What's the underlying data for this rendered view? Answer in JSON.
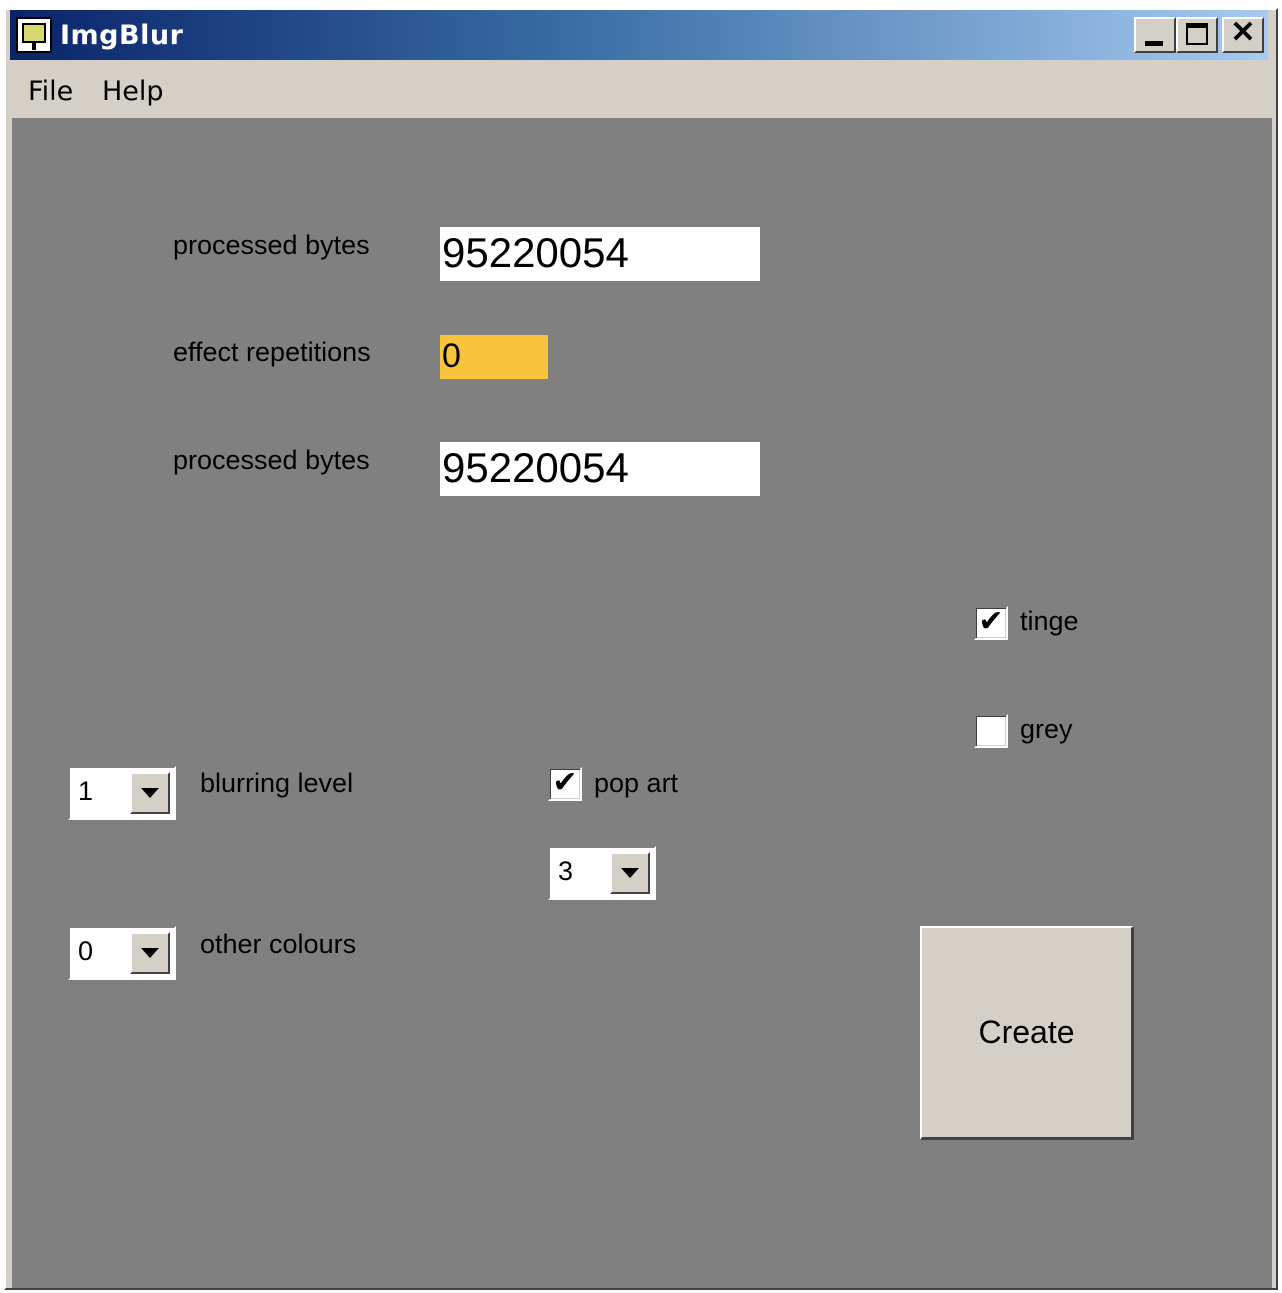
{
  "window": {
    "title": "ImgBlur"
  },
  "menu": {
    "file": "File",
    "help": "Help"
  },
  "fields": {
    "processed_bytes_1": {
      "label": "processed bytes",
      "value": "95220054"
    },
    "effect_repetitions": {
      "label": "effect repetitions",
      "value": "0"
    },
    "processed_bytes_2": {
      "label": "processed bytes",
      "value": "95220054"
    }
  },
  "checkboxes": {
    "tinge": {
      "label": "tinge",
      "checked": true,
      "mark": "✔"
    },
    "grey": {
      "label": "grey",
      "checked": false,
      "mark": ""
    },
    "pop_art": {
      "label": "pop art",
      "checked": true,
      "mark": "✔"
    }
  },
  "combos": {
    "blurring_level": {
      "label": "blurring level",
      "value": "1"
    },
    "other_colours": {
      "label": "other colours",
      "value": "0"
    },
    "pop_art_level": {
      "value": "3"
    }
  },
  "buttons": {
    "create": "Create"
  },
  "colors": {
    "client_bg": "#808080",
    "chrome": "#d4d0c8",
    "highlight_field": "#f8c53c",
    "titlebar_start": "#0a246a",
    "titlebar_end": "#a6caf0"
  }
}
